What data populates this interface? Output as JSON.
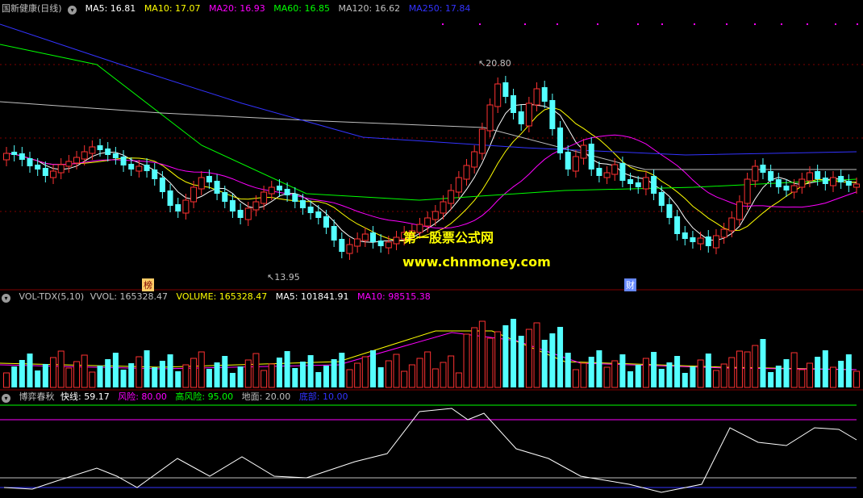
{
  "main_header": {
    "title": "国新健康(日线)",
    "ma5": "MA5: 16.81",
    "ma10": "MA10: 17.07",
    "ma20": "MA20: 16.93",
    "ma60": "MA60: 16.85",
    "ma120": "MA120: 16.62",
    "ma250": "MA250: 17.84"
  },
  "main_chart": {
    "high_label": "20.80",
    "low_label": "13.95",
    "tag_left": "榜",
    "tag_right": "财",
    "watermark_cn": "第一股票公式网",
    "watermark_url": "www.chnmoney.com"
  },
  "vol_header": {
    "name": "VOL-TDX(5,10)",
    "vvol": "VVOL: 165328.47",
    "volume": "VOLUME: 165328.47",
    "ma5": "MA5: 101841.91",
    "ma10": "MA10: 98515.38"
  },
  "ind_header": {
    "name": "博弈春秋",
    "fast": "快线: 59.17",
    "risk": "风险: 80.00",
    "high_risk": "高风险: 95.00",
    "ground": "地面: 20.00",
    "bottom": "底部: 10.00"
  },
  "colors": {
    "up": "#ff3232",
    "down": "#54ffff",
    "ma5": "#ffffff",
    "ma10": "#ffff00",
    "ma20": "#ff00ff",
    "ma60": "#00ff00",
    "ma120": "#c0c0c0",
    "ma250": "#3333ff"
  }
}
